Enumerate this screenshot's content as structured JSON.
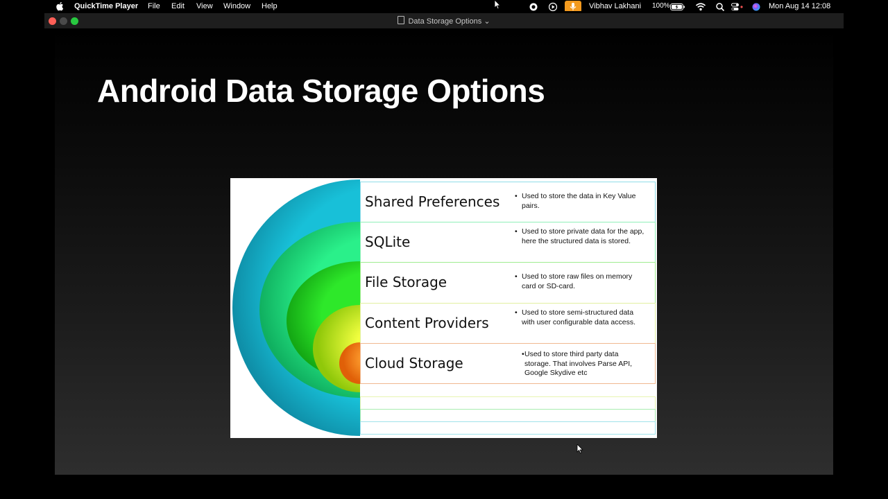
{
  "menubar": {
    "app_name": "QuickTime Player",
    "menus": [
      "File",
      "Edit",
      "View",
      "Window",
      "Help"
    ],
    "user": "Vibhav Lakhani",
    "battery": "100%",
    "datetime": "Mon Aug 14  12:08"
  },
  "window": {
    "title": "Data Storage Options"
  },
  "slide": {
    "heading": "Android Data Storage Options",
    "rows": [
      {
        "title": "Shared Preferences",
        "desc": "Used to store the data in Key Value pairs.",
        "bullet": "•"
      },
      {
        "title": "SQLite",
        "desc": "Used to store private data for the app, here the structured data is stored.",
        "bullet": "•"
      },
      {
        "title": "File Storage",
        "desc": "Used to store raw files on memory card or SD-card.",
        "bullet": "•"
      },
      {
        "title": "Content Providers",
        "desc": "Used to store semi-structured data with user configurable data access.",
        "bullet": "•"
      },
      {
        "title": "Cloud Storage",
        "desc": "Used to store third party data storage. That involves Parse API, Google Skydive etc",
        "bullet": "•"
      }
    ]
  },
  "colors": {
    "ring_teal": "#12b6d0",
    "ring_green_light": "#1ee878",
    "ring_green": "#22dd22",
    "ring_yellow": "#d2ef1a",
    "core_orange": "#f07a10"
  }
}
